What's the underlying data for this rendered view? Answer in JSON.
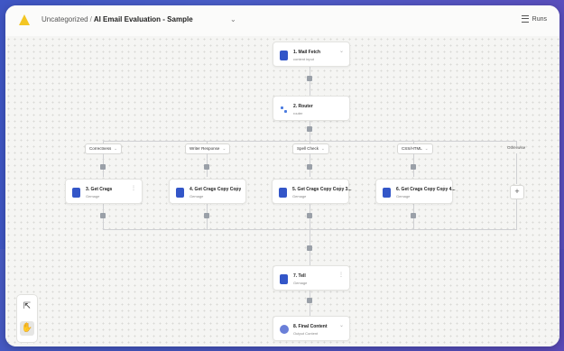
{
  "header": {
    "breadcrumb_folder": "Uncategorized",
    "breadcrumb_sep": "/",
    "title": "AI Email Evaluation - Sample",
    "chevron": "⌄",
    "runs_label": "Runs",
    "runs_icon": "list-icon"
  },
  "nodes": {
    "mail_fetch": {
      "title": "1. Mail Fetch",
      "sub": "content input",
      "icon": "document-icon",
      "menu": "⌄"
    },
    "router": {
      "title": "2. Router",
      "sub": "router",
      "icon": "router-icon",
      "menu": "⌄"
    },
    "branch_1": {
      "title": "3. Get Crags",
      "sub": "Gemage",
      "icon": "document-icon",
      "menu": "⋮"
    },
    "branch_2": {
      "title": "4. Get Crags Copy Copy",
      "sub": "Gemage",
      "icon": "document-icon",
      "menu": "⋮"
    },
    "branch_3": {
      "title": "5. Get Crags Copy Copy 3...",
      "sub": "Gemage",
      "icon": "document-icon",
      "menu": "⋮"
    },
    "branch_4": {
      "title": "6. Get Crags Copy Copy 4...",
      "sub": "Gemage",
      "icon": "document-icon",
      "menu": "⋮"
    },
    "tell": {
      "title": "7. Tell",
      "sub": "Gemage",
      "icon": "document-icon",
      "menu": "⋮"
    },
    "final": {
      "title": "8. Final Content",
      "sub": "Output Content",
      "icon": "merge-icon",
      "menu": "⌄"
    }
  },
  "branches": {
    "pill_1": "Correctness",
    "pill_2": "Writer Response",
    "pill_3": "Spell Check",
    "pill_4": "CSS/HTML",
    "pill_5": "Otherwise",
    "pill_chevron": "⌄",
    "add_label": "+"
  },
  "tools": {
    "pointer_glyph": "⇱",
    "hand_glyph": "✋",
    "pointer_icon": "pointer-icon",
    "hand_icon": "hand-icon"
  },
  "colors": {
    "background_accent": "#4b5fc9",
    "node_icon": "#3356c8",
    "connector": "#cfd0d3",
    "handle": "#9aa0a8"
  }
}
